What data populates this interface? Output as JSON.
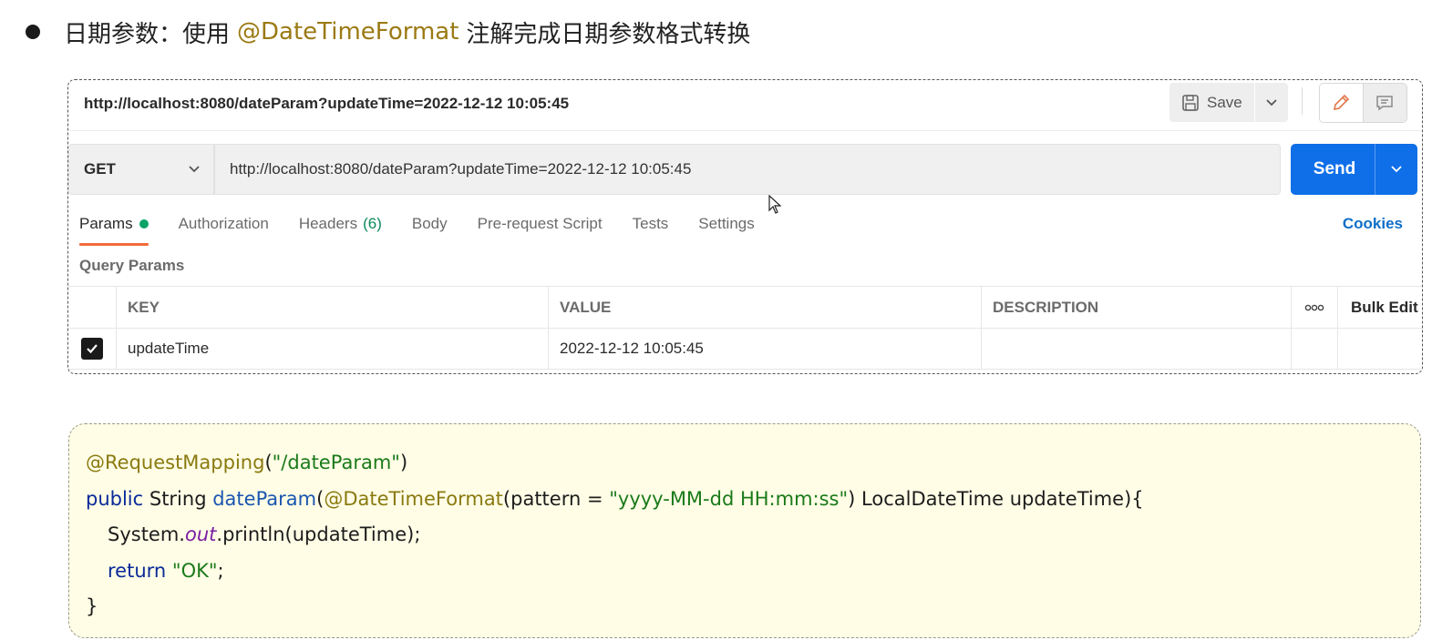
{
  "heading": {
    "prefix": "日期参数：使用",
    "annotation": "@DateTimeFormat",
    "suffix": "注解完成日期参数格式转换"
  },
  "postman": {
    "request_title": "http://localhost:8080/dateParam?updateTime=2022-12-12 10:05:45",
    "save_label": "Save",
    "method": "GET",
    "url": "http://localhost:8080/dateParam?updateTime=2022-12-12 10:05:45",
    "send_label": "Send",
    "tabs": [
      {
        "label": "Params",
        "has_dot": true
      },
      {
        "label": "Authorization"
      },
      {
        "label": "Headers",
        "count": "(6)"
      },
      {
        "label": "Body"
      },
      {
        "label": "Pre-request Script"
      },
      {
        "label": "Tests"
      },
      {
        "label": "Settings"
      }
    ],
    "cookies_label": "Cookies",
    "query_params_label": "Query Params",
    "table": {
      "headers": {
        "key": "KEY",
        "value": "VALUE",
        "description": "DESCRIPTION",
        "more": "ooo",
        "bulk_edit": "Bulk Edit"
      },
      "rows": [
        {
          "checked": true,
          "key": "updateTime",
          "value": "2022-12-12 10:05:45",
          "description": ""
        }
      ]
    },
    "colors": {
      "send": "#0f6fe8",
      "active_tab_underline": "#f26b3a",
      "params_dot": "#0ba36a",
      "cookies": "#0f6fc7"
    }
  },
  "code": {
    "line1": {
      "annotation": "@RequestMapping",
      "open": "(",
      "string": "\"/dateParam\"",
      "close": ")"
    },
    "line2": {
      "kw": "public",
      "type": " String ",
      "method": "dateParam",
      "open": "(",
      "annotation": "@DateTimeFormat",
      "paren": "(pattern = ",
      "string": "\"yyyy-MM-dd HH:mm:ss\"",
      "rest": ") LocalDateTime updateTime){"
    },
    "line3": {
      "obj": "System.",
      "field": "out",
      "rest": ".println(updateTime);"
    },
    "line4": {
      "kw": "return",
      "space": " ",
      "string": "\"OK\"",
      "end": ";"
    },
    "line5": {
      "text": "}"
    }
  }
}
